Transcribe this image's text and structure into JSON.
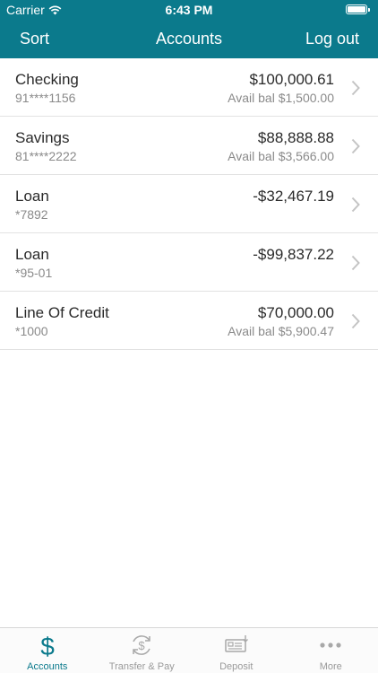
{
  "status_bar": {
    "carrier": "Carrier",
    "time": "6:43 PM"
  },
  "nav": {
    "sort_label": "Sort",
    "title": "Accounts",
    "logout_label": "Log out"
  },
  "accounts": [
    {
      "name": "Checking",
      "number": "91****1156",
      "balance": "$100,000.61",
      "available": "Avail bal $1,500.00"
    },
    {
      "name": "Savings",
      "number": "81****2222",
      "balance": "$88,888.88",
      "available": "Avail bal $3,566.00"
    },
    {
      "name": "Loan",
      "number": "*7892",
      "balance": "-$32,467.19",
      "available": ""
    },
    {
      "name": "Loan",
      "number": "*95-01",
      "balance": "-$99,837.22",
      "available": ""
    },
    {
      "name": "Line Of Credit",
      "number": "*1000",
      "balance": "$70,000.00",
      "available": "Avail bal $5,900.47"
    }
  ],
  "tabbar": {
    "accounts": "Accounts",
    "transfer_pay": "Transfer & Pay",
    "deposit": "Deposit",
    "more": "More"
  },
  "colors": {
    "brand": "#0b7a8c",
    "text": "#2a2a2a",
    "secondary": "#8a8a8a",
    "tab_inactive": "#9a9a9a"
  },
  "icons": {
    "accounts": "dollar-icon",
    "transfer_pay": "transfer-dollar-icon",
    "deposit": "check-deposit-icon",
    "more": "more-dots-icon"
  }
}
